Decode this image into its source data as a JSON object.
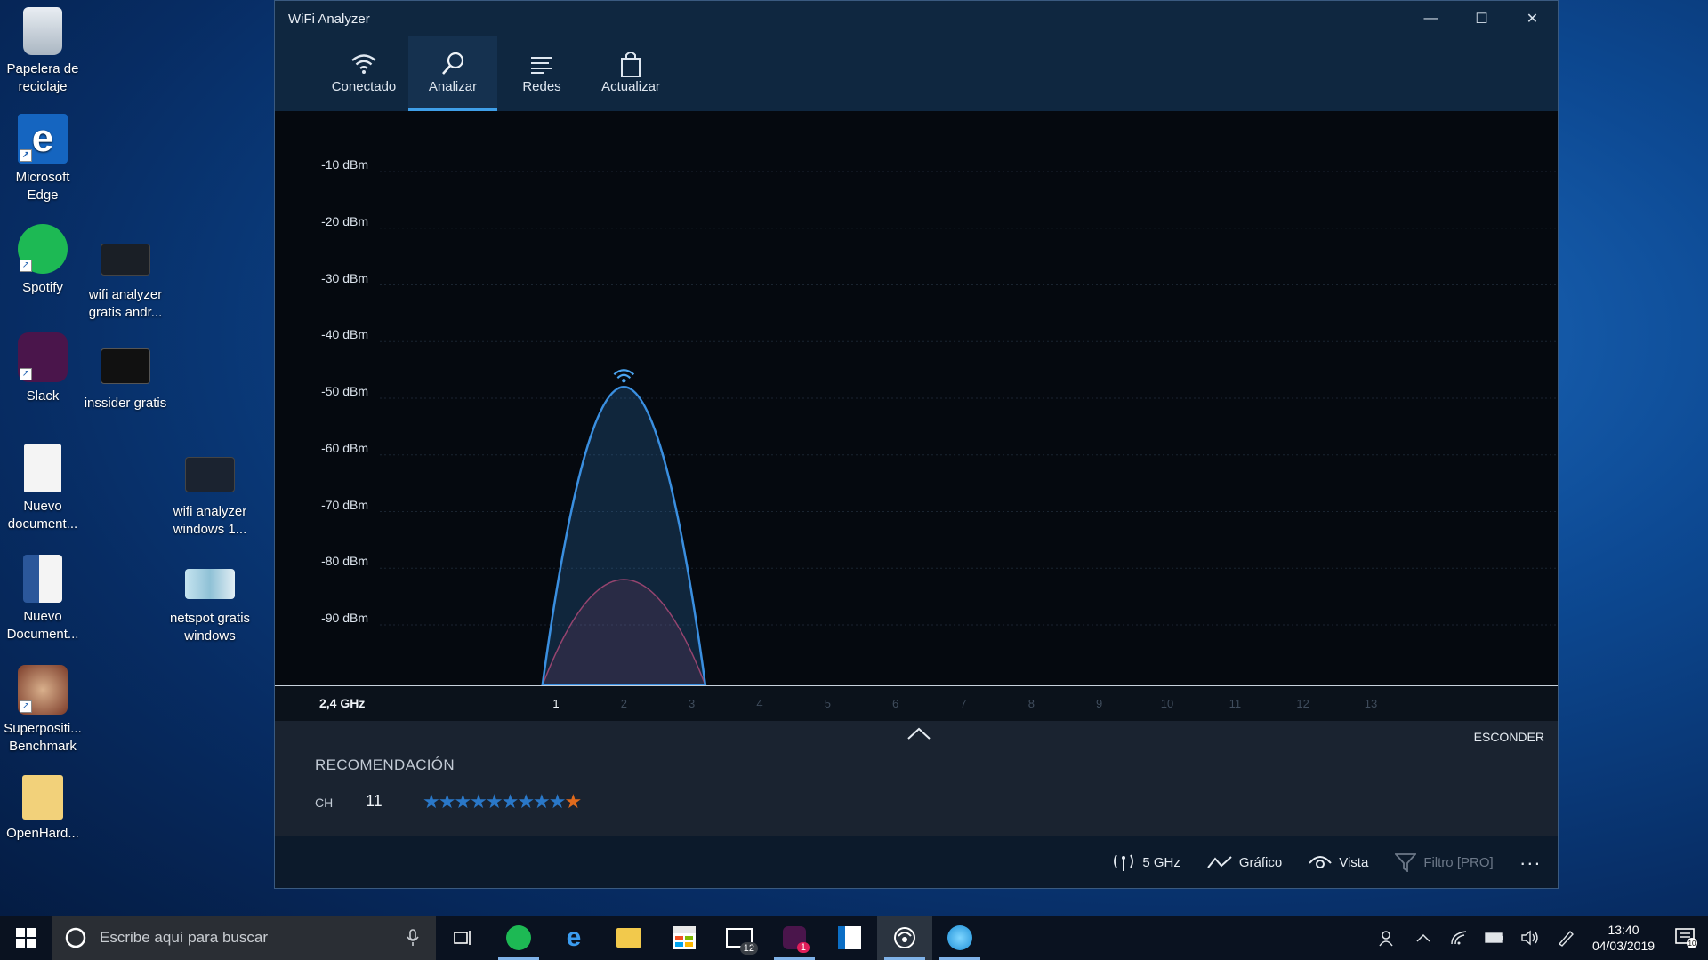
{
  "desktop": {
    "icons": [
      {
        "label": "Papelera de reciclaje"
      },
      {
        "label": "Microsoft Edge"
      },
      {
        "label": "Spotify"
      },
      {
        "label": "wifi analyzer gratis andr..."
      },
      {
        "label": "Slack"
      },
      {
        "label": "inssider gratis"
      },
      {
        "label": "Nuevo document..."
      },
      {
        "label": "wifi analyzer windows 1..."
      },
      {
        "label": "Nuevo Document..."
      },
      {
        "label": "netspot gratis windows"
      },
      {
        "label": "Superpositi... Benchmark"
      },
      {
        "label": "OpenHard..."
      }
    ]
  },
  "window": {
    "title": "WiFi Analyzer",
    "controls": {
      "minimize": "—",
      "maximize": "☐",
      "close": "✕"
    },
    "toolbar": [
      {
        "label": "Conectado",
        "icon": "wifi-icon",
        "active": false
      },
      {
        "label": "Analizar",
        "icon": "search-icon",
        "active": true
      },
      {
        "label": "Redes",
        "icon": "list-icon",
        "active": false
      },
      {
        "label": "Actualizar",
        "icon": "shopping-bag-icon",
        "active": false
      }
    ]
  },
  "chart_data": {
    "type": "area",
    "y_tick_labels": [
      "-10 dBm",
      "-20 dBm",
      "-30 dBm",
      "-40 dBm",
      "-50 dBm",
      "-60 dBm",
      "-70 dBm",
      "-80 dBm",
      "-90 dBm"
    ],
    "ylim": [
      -100,
      -5
    ],
    "x_label": "2,4 GHz",
    "x_ticks": [
      "1",
      "2",
      "3",
      "4",
      "5",
      "6",
      "7",
      "8",
      "9",
      "10",
      "11",
      "12",
      "13"
    ],
    "active_channel": "1",
    "grid": true,
    "series": [
      {
        "channel_center": 1,
        "channel_span": [
          -1.2,
          3.2
        ],
        "peak_dbm": -48,
        "color": "#3a8fe0",
        "wifi_marker": true
      },
      {
        "channel_center": 1,
        "channel_span": [
          -1.2,
          3.2
        ],
        "peak_dbm": -82,
        "color": "#b03050"
      }
    ]
  },
  "recommendation": {
    "hide_label": "ESCONDER",
    "title": "RECOMENDACIÓN",
    "ch_label": "CH",
    "channel": "11",
    "stars_blue": "★★★★★★★★★",
    "stars_orange": "★"
  },
  "bottom_bar": {
    "band": "5 GHz",
    "graph": "Gráfico",
    "view": "Vista",
    "filter": "Filtro [PRO]",
    "more": "..."
  },
  "taskbar": {
    "search_placeholder": "Escribe aquí para buscar",
    "mail_badge": "12",
    "slack_badge": "1",
    "time": "13:40",
    "date": "04/03/2019",
    "notif_count": "10"
  },
  "colors": {
    "accent": "#3f9fe8",
    "signal": "#3a8fe0",
    "signal_secondary": "#b03050",
    "star_orange": "#e06a1c"
  }
}
